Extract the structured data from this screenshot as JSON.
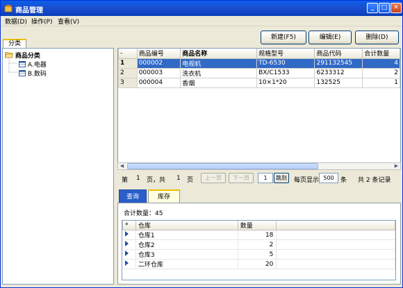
{
  "window": {
    "title": "商品管理"
  },
  "menu": [
    {
      "label": "数据(D)"
    },
    {
      "label": "操作(P)"
    },
    {
      "label": "查看(V)"
    }
  ],
  "toolbar": {
    "new_label": "新建(F5)",
    "edit_label": "编辑(E)",
    "delete_label": "删除(D)"
  },
  "left_tab": "分类",
  "tree": {
    "root": "商品分类",
    "children": [
      "A.电器",
      "B.数码"
    ]
  },
  "grid": {
    "columns": [
      "-",
      "商品编号",
      "商品名称",
      "规格型号",
      "商品代码",
      "合计数量"
    ],
    "rows": [
      {
        "idx": "1",
        "code": "000002",
        "name": "电视机",
        "spec": "TD-6530",
        "barcode": "291132545",
        "qty": "4"
      },
      {
        "idx": "2",
        "code": "000003",
        "name": "洗衣机",
        "spec": "BX/C1533",
        "barcode": "6233312",
        "qty": "2"
      },
      {
        "idx": "3",
        "code": "000004",
        "name": "香烟",
        "spec": "10×1*20",
        "barcode": "132525",
        "qty": "1"
      }
    ]
  },
  "pager": {
    "page_prefix": "第",
    "page_num": "1",
    "page_mid": "页，共",
    "total_pages": "1",
    "page_suffix": "页",
    "prev_label": "上一页",
    "next_label": "下一页",
    "jump_value": "1",
    "jump_label": "跳到",
    "per_page_label": "每页显示",
    "per_page_value": "500",
    "per_page_unit": "条",
    "total_text": "共 2 条记录"
  },
  "bottom_tabs": {
    "query": "查询",
    "stock": "库存"
  },
  "stock": {
    "total_label": "合计数量：45",
    "columns": [
      "*",
      "仓库",
      "数量"
    ],
    "rows": [
      {
        "warehouse": "仓库1",
        "qty": "18"
      },
      {
        "warehouse": "仓库2",
        "qty": "2"
      },
      {
        "warehouse": "仓库3",
        "qty": "5"
      },
      {
        "warehouse": "二环仓库",
        "qty": "20"
      }
    ]
  },
  "colors": {
    "title_bar": "#0a5fe8",
    "selection": "#316ac5",
    "accent_tab": "#f0c000"
  }
}
